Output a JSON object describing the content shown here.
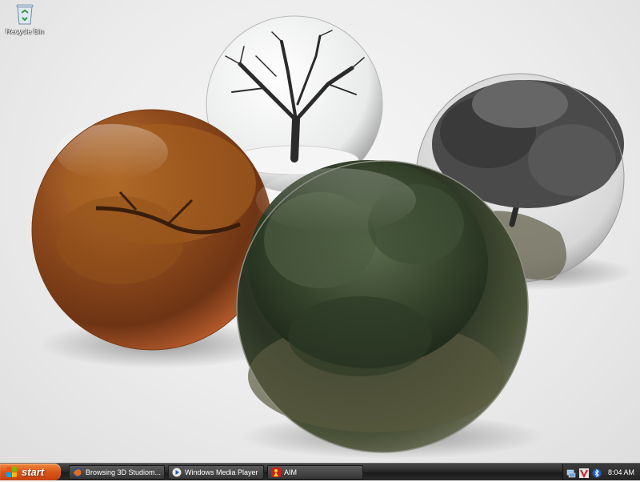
{
  "desktop": {
    "icons": [
      {
        "label": "Recycle Bin",
        "icon": "recycle-bin-icon"
      }
    ],
    "wallpaper": "four glass spheres containing trees"
  },
  "taskbar": {
    "start_label": "start",
    "tasks": [
      {
        "label": "Browsing 3D Studiom...",
        "icon": "firefox-icon"
      },
      {
        "label": "Windows Media Player",
        "icon": "media-player-icon"
      },
      {
        "label": "AIM",
        "icon": "aim-icon"
      }
    ],
    "tray": {
      "icons": [
        "network-icon",
        "antivirus-icon",
        "bluetooth-icon"
      ],
      "clock": "8:04 AM"
    }
  },
  "colors": {
    "start_button": "#d9561b",
    "taskbar": "#2b2b2b"
  }
}
